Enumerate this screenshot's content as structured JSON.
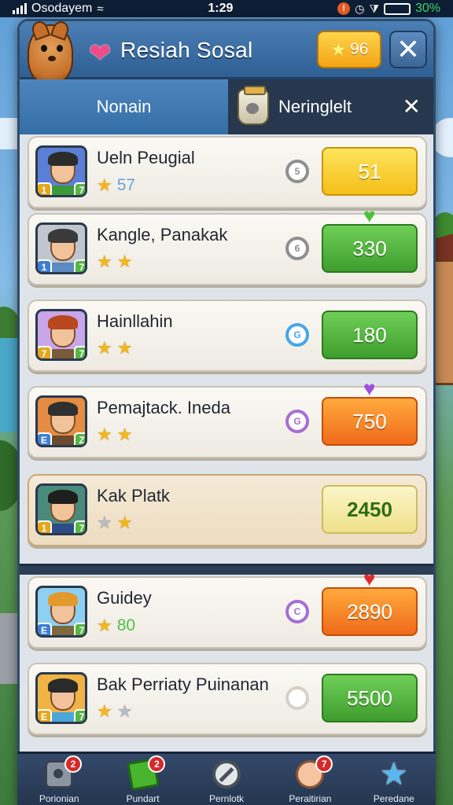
{
  "status_bar": {
    "carrier": "Osodayem",
    "time": "1:29",
    "battery": "30%"
  },
  "header": {
    "title": "Resiah Sosal",
    "star_count": "96"
  },
  "tabs": [
    {
      "label": "Nonain"
    },
    {
      "label": "Neringlelt"
    }
  ],
  "rows": [
    {
      "name": "Ueln Peugial",
      "stars": [
        "gold"
      ],
      "star_note": "57",
      "star_note_color": "#6aa3d9",
      "value": "51",
      "value_style": "yellow",
      "magnifier_color": "#8f8f8f",
      "magnifier_glyph": "5",
      "chips": [
        "1",
        "7"
      ],
      "hair": "#2b2b2b",
      "shirt": "#3a9a3a",
      "bg": "#5b7fd6"
    },
    {
      "name": "Kangle, Panakak",
      "stars": [
        "gold",
        "gold"
      ],
      "value": "330",
      "value_style": "green",
      "magnifier_color": "#8f8f8f",
      "magnifier_glyph": "6",
      "top_heart": "♥",
      "top_heart_color": "#4fc23c",
      "chips": [
        "1",
        "7"
      ],
      "hair": "#3a3a3a",
      "shirt": "#5b8bc2",
      "bg": "#bfc6ce"
    },
    {
      "name": "Hainllahin",
      "stars": [
        "gold",
        "gold"
      ],
      "value": "180",
      "value_style": "green",
      "magnifier_color": "#46a6e8",
      "magnifier_glyph": "G",
      "chips": [
        "7",
        "7"
      ],
      "hair": "#b8471e",
      "shirt": "#7a5a3a",
      "bg": "#c9a6e9"
    },
    {
      "name": "Pemajtack. Ineda",
      "stars": [
        "gold",
        "gold"
      ],
      "value": "750",
      "value_style": "orange",
      "magnifier_color": "#a56fd1",
      "magnifier_glyph": "G",
      "top_heart": "♥",
      "top_heart_color": "#a04ee0",
      "chips": [
        "E",
        "Z"
      ],
      "hair": "#2f2f2f",
      "shirt": "#6b4a30",
      "bg": "#e48c43"
    },
    {
      "name": "Kak Platk",
      "stars": [
        "grey",
        "gold"
      ],
      "value": "2450",
      "value_style": "pale",
      "chips": [
        "1",
        "7"
      ],
      "hair": "#1e1e1e",
      "shirt": "#2e4c86",
      "bg": "#4a8a7a",
      "highlight": true
    },
    {
      "name": "Guidey",
      "stars": [
        "gold"
      ],
      "star_note": "80",
      "star_note_color": "#4fbf4a",
      "value": "2890",
      "value_style": "orange",
      "magnifier_color": "#a56fd1",
      "magnifier_glyph": "C",
      "top_heart": "♥",
      "top_heart_color": "#e0282f",
      "chips": [
        "E",
        "7"
      ],
      "hair": "#e29a2d",
      "shirt": "#7a6a3c",
      "bg": "#8ed0f2"
    },
    {
      "name": "Bak Perriaty Puinanan",
      "stars": [
        "gold",
        "grey"
      ],
      "value": "5500",
      "value_style": "green",
      "magnifier_color": "#d7d0c6",
      "magnifier_glyph": "",
      "chips": [
        "E",
        "7"
      ],
      "hair": "#2a2a2a",
      "shirt": "#4aa7d9",
      "bg": "#f0b445"
    }
  ],
  "bottom_nav": [
    {
      "label": "Porionian",
      "badge": "2",
      "icon": "camera-icon"
    },
    {
      "label": "Pundart",
      "badge": "2",
      "icon": "note-icon"
    },
    {
      "label": "Pernlotk",
      "badge": "",
      "icon": "blocked-icon"
    },
    {
      "label": "Peraitirian",
      "badge": "7",
      "icon": "face-icon"
    },
    {
      "label": "Peredane",
      "badge": "",
      "icon": "star-icon"
    }
  ]
}
